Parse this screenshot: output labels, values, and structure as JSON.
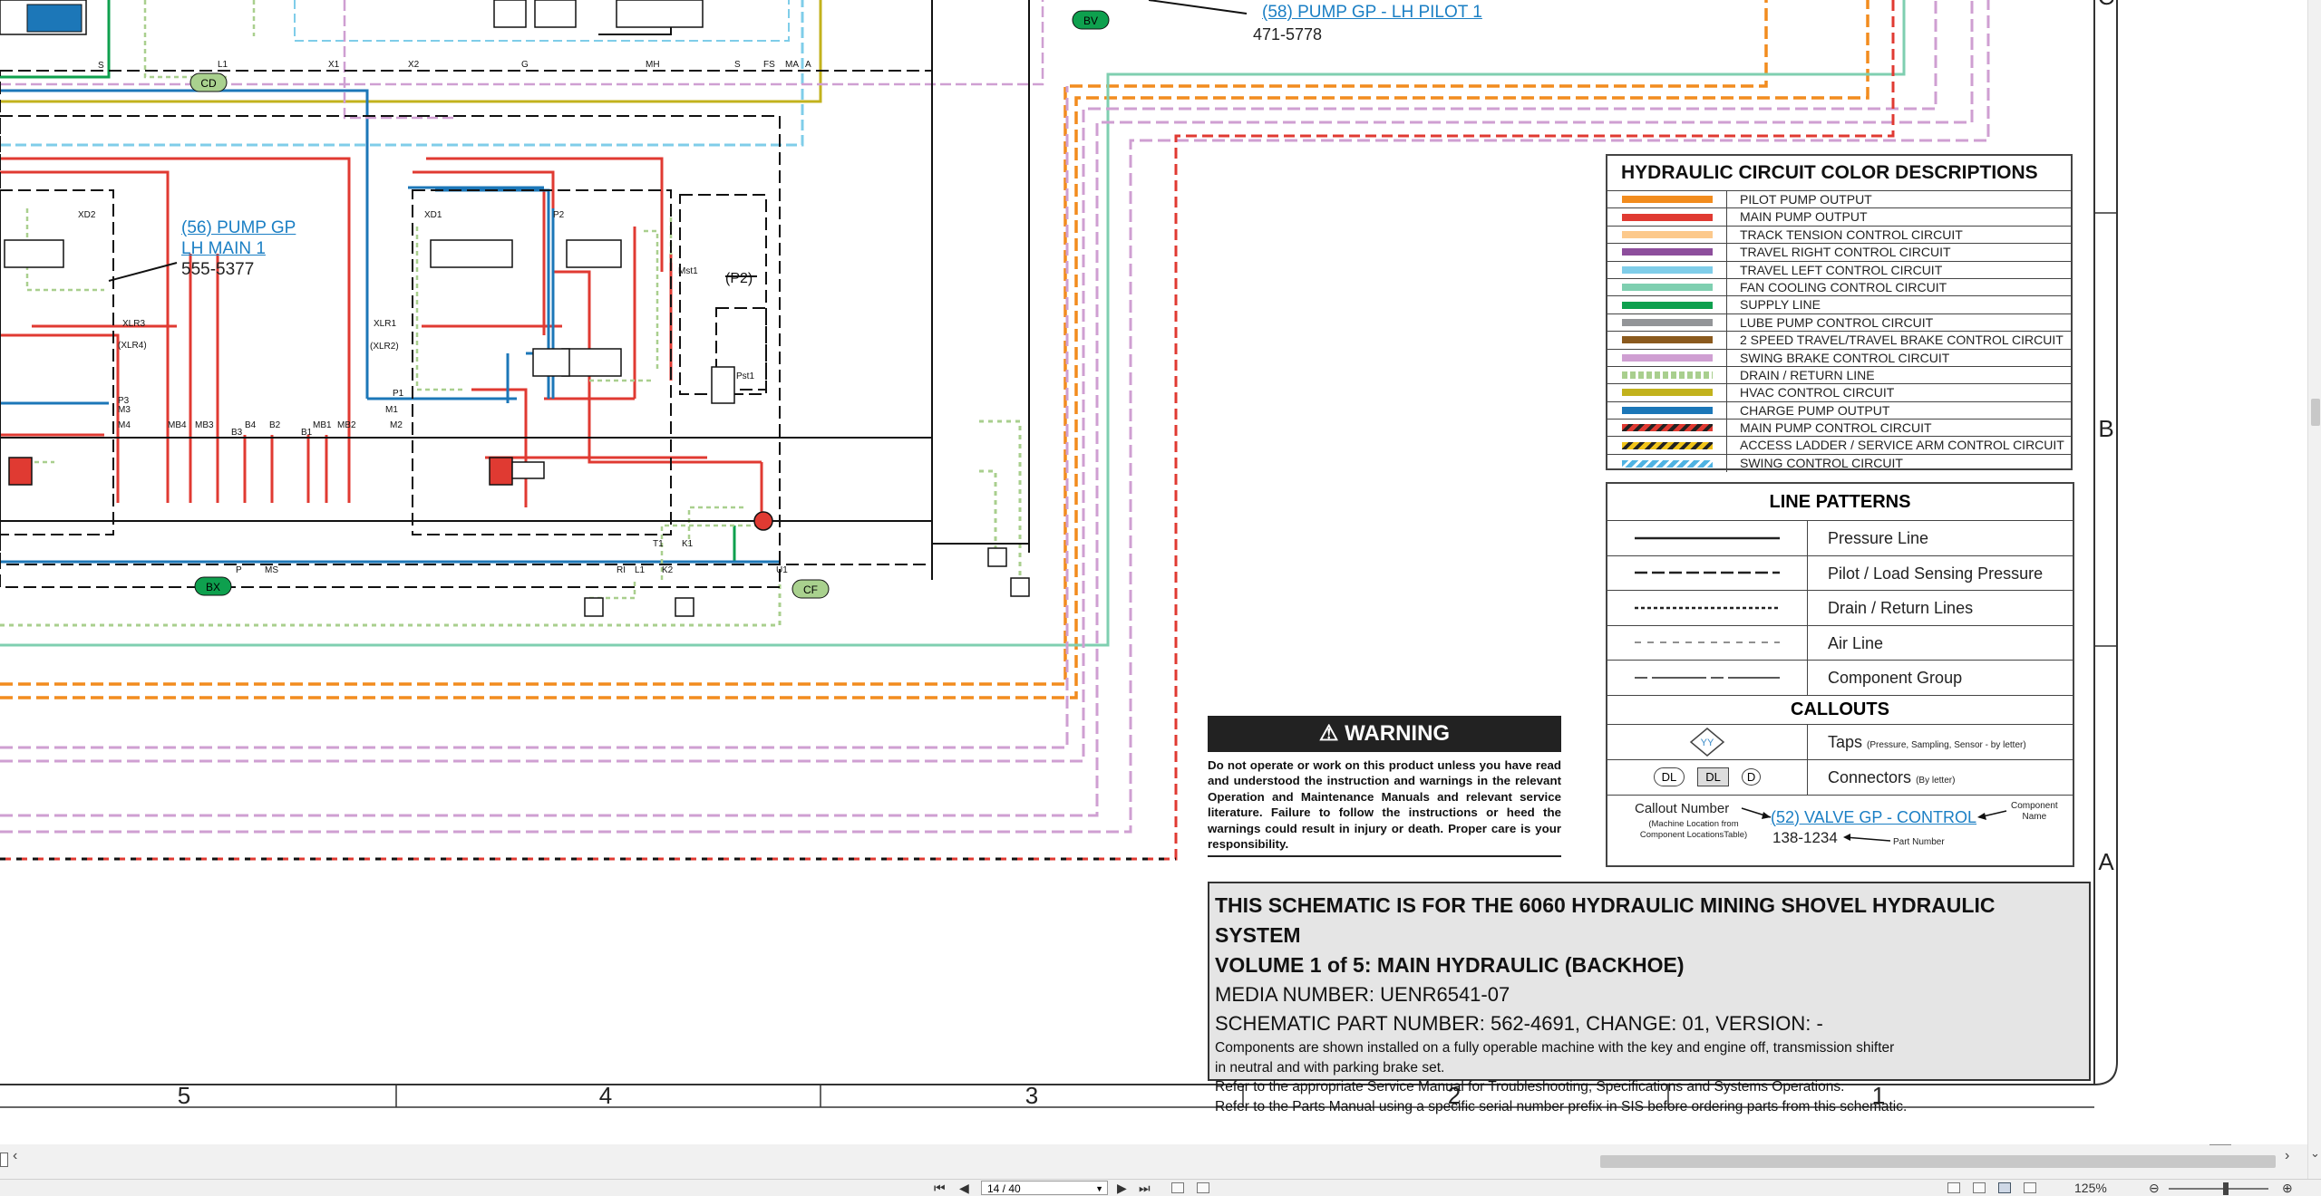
{
  "schematic": {
    "callouts": {
      "pump_pilot": {
        "name": "(58) PUMP GP - LH PILOT 1",
        "part": "471-5778"
      },
      "pump_main": {
        "name_line1": "(56) PUMP GP",
        "name_line2": "LH MAIN 1",
        "part": "555-5377"
      }
    },
    "connectors": {
      "bv": "BV",
      "cd": "CD",
      "bx": "BX",
      "cf": "CF"
    },
    "port_labels": [
      "S",
      "L1",
      "X1",
      "X2",
      "G",
      "MH",
      "S",
      "FS",
      "MA",
      "A",
      "XD2",
      "XD1",
      "P2",
      "Mst1",
      "(P2)",
      "XLR3",
      "(XLR4)",
      "XLR1",
      "(XLR2)",
      "P3",
      "M3",
      "M4",
      "P1",
      "M1",
      "M2",
      "MB4",
      "MB3",
      "B3",
      "B4",
      "B2",
      "B1",
      "MB1",
      "MB2",
      "Pst1",
      "T1",
      "K1",
      "RI",
      "L1",
      "K2",
      "U1",
      "P",
      "MS"
    ],
    "grid_columns": [
      "5",
      "4",
      "3",
      "2",
      "1"
    ],
    "grid_rows": [
      "C",
      "B",
      "A"
    ]
  },
  "color_legend": {
    "title": "HYDRAULIC CIRCUIT COLOR DESCRIPTIONS",
    "items": [
      {
        "label": "PILOT PUMP OUTPUT",
        "color": "#f28c1e",
        "pattern": "solid"
      },
      {
        "label": "MAIN PUMP OUTPUT",
        "color": "#e03a32",
        "pattern": "solid"
      },
      {
        "label": "TRACK TENSION CONTROL CIRCUIT",
        "color": "#fcc98c",
        "pattern": "solid"
      },
      {
        "label": "TRAVEL RIGHT CONTROL CIRCUIT",
        "color": "#8d4e9c",
        "pattern": "solid"
      },
      {
        "label": "TRAVEL LEFT CONTROL CIRCUIT",
        "color": "#7fcde9",
        "pattern": "solid"
      },
      {
        "label": "FAN COOLING CONTROL CIRCUIT",
        "color": "#7fcfb0",
        "pattern": "solid"
      },
      {
        "label": "SUPPLY LINE",
        "color": "#0ea04e",
        "pattern": "solid"
      },
      {
        "label": "LUBE PUMP CONTROL CIRCUIT",
        "color": "#939598",
        "pattern": "solid"
      },
      {
        "label": "2 SPEED TRAVEL/TRAVEL BRAKE CONTROL CIRCUIT",
        "color": "#8b5a1e",
        "pattern": "solid"
      },
      {
        "label": "SWING BRAKE CONTROL CIRCUIT",
        "color": "#cf9fd2",
        "pattern": "solid"
      },
      {
        "label": "DRAIN / RETURN LINE",
        "color": "#a9cf8e",
        "pattern": "dotted"
      },
      {
        "label": "HVAC CONTROL CIRCUIT",
        "color": "#c2b21c",
        "pattern": "solid"
      },
      {
        "label": "CHARGE PUMP OUTPUT",
        "color": "#1c77b8",
        "pattern": "solid"
      },
      {
        "label": "MAIN PUMP CONTROL CIRCUIT",
        "color": "#e03a32",
        "pattern": "stripe-black"
      },
      {
        "label": "ACCESS LADDER / SERVICE ARM CONTROL CIRCUIT",
        "color": "#f0c419",
        "pattern": "stripe-black"
      },
      {
        "label": "SWING CONTROL CIRCUIT",
        "color": "#4fb3e3",
        "pattern": "stripe-white"
      }
    ]
  },
  "line_patterns": {
    "title": "LINE PATTERNS",
    "items": [
      {
        "label": "Pressure Line",
        "style": "solid"
      },
      {
        "label": "Pilot / Load Sensing Pressure",
        "style": "dashed"
      },
      {
        "label": "Drain / Return Lines",
        "style": "dotted"
      },
      {
        "label": "Air Line",
        "style": "thin-dashed"
      },
      {
        "label": "Component Group",
        "style": "dash-long"
      }
    ]
  },
  "callouts_legend": {
    "title": "CALLOUTS",
    "taps_label": "Taps",
    "taps_note": "(Pressure, Sampling, Sensor - by letter)",
    "taps_symbol": "YY",
    "connectors_label": "Connectors",
    "connectors_note": "(By letter)",
    "connector_symbols": [
      "DL",
      "DL",
      "D"
    ],
    "example_callout_label": "Callout Number",
    "example_callout_note_1": "(Machine Location from",
    "example_callout_note_2": "Component LocationsTable)",
    "example_name": "(52) VALVE GP - CONTROL",
    "example_part": "138-1234",
    "component_name_label_1": "Component",
    "component_name_label_2": "Name",
    "part_number_label": "Part Number"
  },
  "warning": {
    "title": "WARNING",
    "text": "Do not operate or work on this product unless you have read and understood the instruction and warnings in the relevant Operation and Maintenance Manuals and relevant service literature. Failure to follow the instructions or heed the warnings could result in injury or death. Proper care is your responsibility."
  },
  "title_block": {
    "line1": "THIS SCHEMATIC IS FOR THE 6060 HYDRAULIC MINING SHOVEL HYDRAULIC SYSTEM",
    "line2": "VOLUME 1 of 5: MAIN HYDRAULIC (BACKHOE)",
    "media": "MEDIA NUMBER: UENR6541-07",
    "part": "SCHEMATIC PART NUMBER: 562-4691, CHANGE: 01, VERSION: -",
    "note1": "Components are shown installed on a fully operable machine with the key and engine off, transmission shifter",
    "note2": "in neutral and with parking brake set.",
    "note3": "Refer to the appropriate Service Manual for Troubleshooting, Specifications and Systems Operations.",
    "note4": "Refer to the Parts Manual using a specific serial number prefix in SIS before ordering parts from this schematic."
  },
  "viewer": {
    "page_indicator": "14 / 40",
    "zoom": "125%"
  },
  "colors": {
    "pilot": "#f28c1e",
    "main": "#e03a32",
    "charge": "#1c77b8",
    "fan": "#7fcfb0",
    "swing_brake": "#cf9fd2",
    "drain": "#a9cf8e",
    "supply": "#0ea04e",
    "hvac": "#c2b21c",
    "travel_left": "#7fcde9"
  }
}
